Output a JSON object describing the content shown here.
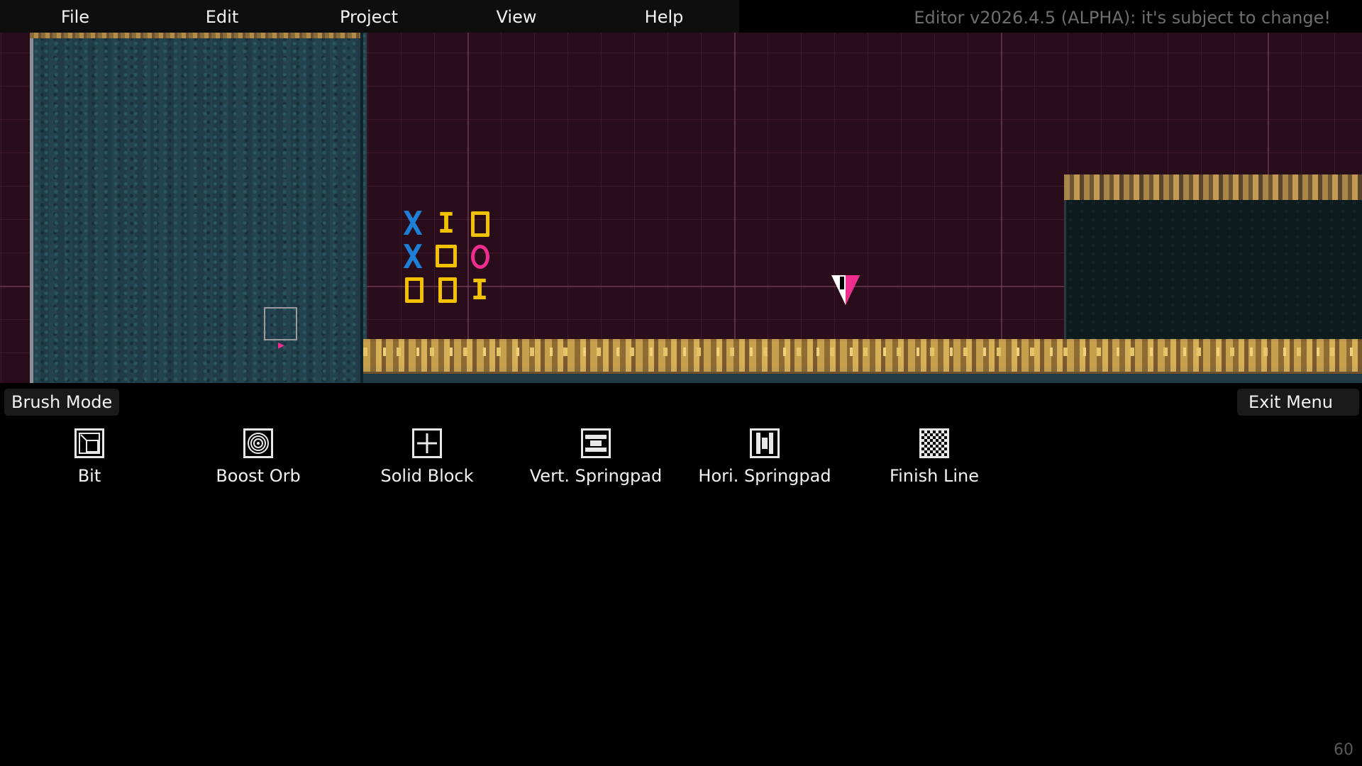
{
  "menubar": {
    "items": [
      "File",
      "Edit",
      "Project",
      "View",
      "Help"
    ],
    "version": "Editor v2026.4.5 (ALPHA): it's subject to change!"
  },
  "level": {
    "bits": [
      "X",
      "I",
      "0",
      "X",
      "0",
      "0",
      "0",
      "0",
      "I"
    ]
  },
  "panel": {
    "mode_label": "Brush Mode",
    "exit_label": "Exit Menu",
    "tools": [
      {
        "label": "Bit",
        "icon": "bit-icon"
      },
      {
        "label": "Boost Orb",
        "icon": "boost-orb-icon"
      },
      {
        "label": "Solid Block",
        "icon": "solid-block-icon"
      },
      {
        "label": "Vert. Springpad",
        "icon": "vert-springpad-icon"
      },
      {
        "label": "Hori. Springpad",
        "icon": "hori-springpad-icon"
      },
      {
        "label": "Finish Line",
        "icon": "finish-line-icon"
      }
    ]
  },
  "fps": "60",
  "colors": {
    "bit_blue": "#1e7fd6",
    "bit_yellow": "#f2c200",
    "accent_pink": "#ee2d8f",
    "grid_bg": "#2a0d1b"
  }
}
